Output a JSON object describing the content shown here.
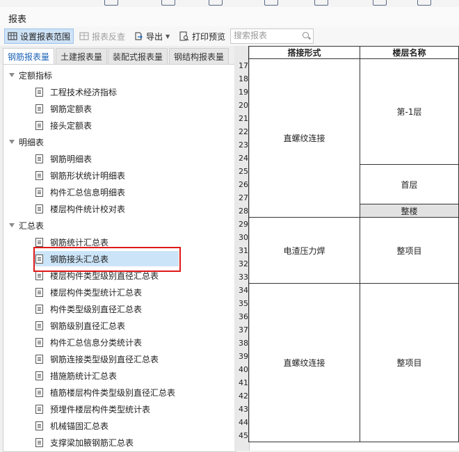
{
  "window": {
    "title": "报表"
  },
  "toolbar": {
    "set_range": "设置报表范围",
    "reverse_check": "报表反查",
    "export": "导出",
    "print_preview": "打印预览",
    "search_placeholder": "搜索报表"
  },
  "tabs": [
    {
      "label": "钢筋报表量",
      "active": true
    },
    {
      "label": "土建报表量",
      "active": false
    },
    {
      "label": "装配式报表量",
      "active": false
    },
    {
      "label": "钢结构报表量",
      "active": false
    }
  ],
  "tree": {
    "groups": [
      {
        "label": "定额指标",
        "items": [
          "工程技术经济指标",
          "钢筋定额表",
          "接头定额表"
        ]
      },
      {
        "label": "明细表",
        "items": [
          "钢筋明细表",
          "钢筋形状统计明细表",
          "构件汇总信息明细表",
          "楼层构件统计校对表"
        ]
      },
      {
        "label": "汇总表",
        "items": [
          "钢筋统计汇总表",
          "钢筋接头汇总表",
          "楼层构件类型级别直径汇总表",
          "楼层构件类型统计汇总表",
          "构件类型级别直径汇总表",
          "钢筋级别直径汇总表",
          "构件汇总信息分类统计表",
          "钢筋连接类型级别直径汇总表",
          "措施筋统计汇总表",
          "植筋楼层构件类型级别直径汇总表",
          "预埋件楼层构件类型统计表",
          "机械锚固汇总表",
          "支撑梁加腋钢筋汇总表"
        ]
      }
    ],
    "selected": "钢筋接头汇总表"
  },
  "table": {
    "headers": [
      "搭接形式",
      "楼层名称"
    ],
    "row_numbers": [
      "17",
      "18",
      "19",
      "20",
      "21",
      "22",
      "23",
      "24",
      "25",
      "26",
      "27",
      "28",
      "29",
      "30",
      "31",
      "32",
      "33",
      "34",
      "35",
      "36",
      "37",
      "38",
      "39",
      "40",
      "41",
      "42",
      "43",
      "44",
      "45"
    ],
    "joint_types": [
      "直螺纹连接",
      "电渣压力焊",
      "直螺纹连接"
    ],
    "floors": [
      "第-1层",
      "首层",
      "整楼",
      "整项目",
      "整项目"
    ]
  },
  "colors": {
    "selection": "#cce4f7",
    "highlight_box": "#e01818",
    "active_tab_text": "#1c63b7"
  }
}
